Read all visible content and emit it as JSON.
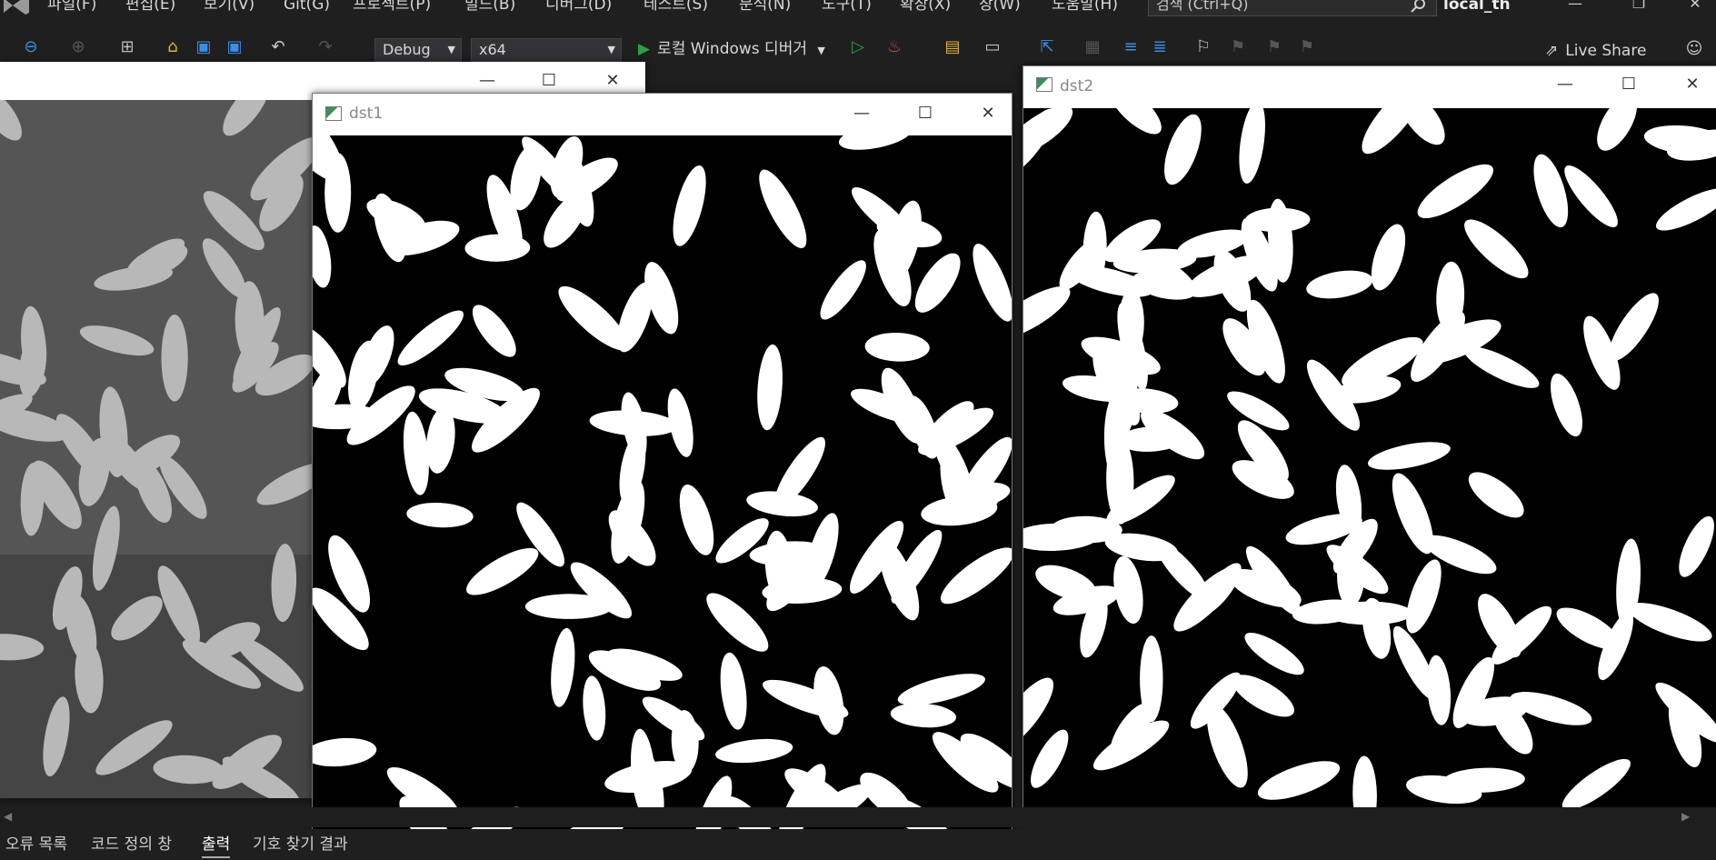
{
  "menu": {
    "items": [
      "파일(F)",
      "편집(E)",
      "보기(V)",
      "Git(G)",
      "프로젝트(P)",
      "빌드(B)",
      "디버그(D)",
      "테스트(S)",
      "분석(N)",
      "도구(T)",
      "확장(X)",
      "창(W)",
      "도움말(H)"
    ],
    "search_placeholder": "검색 (Ctrl+Q)",
    "project_name": "local_th"
  },
  "toolbar": {
    "config": "Debug",
    "platform": "x64",
    "run_target": "로컬 Windows 디버거",
    "live_share": "Live Share"
  },
  "windows": {
    "source": {
      "title": ""
    },
    "dst1": {
      "title": "dst1"
    },
    "dst2": {
      "title": "dst2"
    }
  },
  "bottom_tabs": {
    "error_list": "오류 목록",
    "code_def": "코드 정의 창",
    "output": "출력",
    "find_symbols": "기호 찾기 결과"
  },
  "colors": {
    "vs_background": "#1e1e1e",
    "accent": "#3a8ee6",
    "run_green": "#2ea043"
  }
}
